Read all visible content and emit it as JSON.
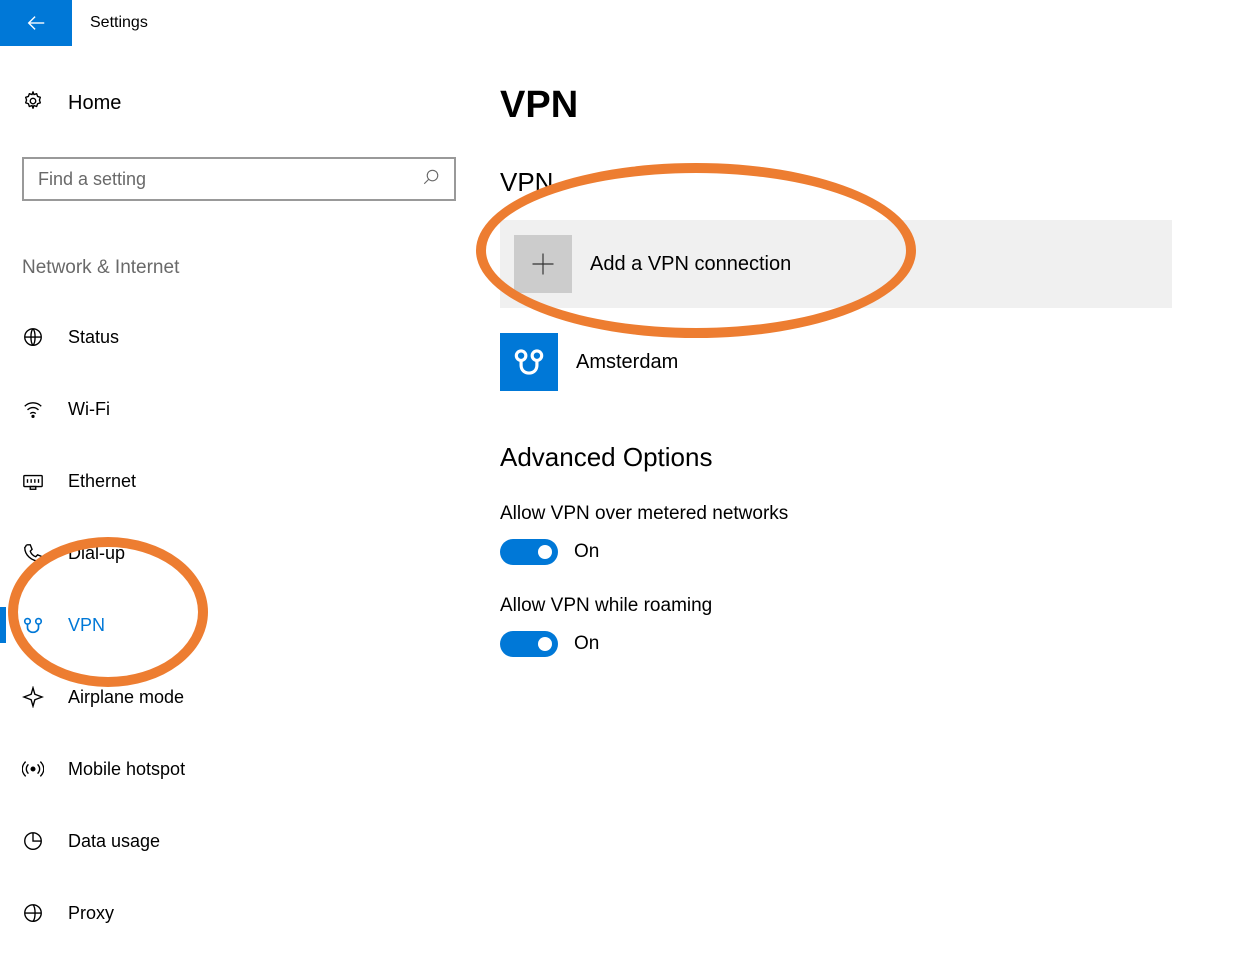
{
  "header": {
    "title": "Settings"
  },
  "sidebar": {
    "home": "Home",
    "search_placeholder": "Find a setting",
    "section": "Network & Internet",
    "items": [
      {
        "label": "Status"
      },
      {
        "label": "Wi-Fi"
      },
      {
        "label": "Ethernet"
      },
      {
        "label": "Dial-up"
      },
      {
        "label": "VPN",
        "active": true
      },
      {
        "label": "Airplane mode"
      },
      {
        "label": "Mobile hotspot"
      },
      {
        "label": "Data usage"
      },
      {
        "label": "Proxy"
      }
    ]
  },
  "main": {
    "title": "VPN",
    "vpn_section": "VPN",
    "add_label": "Add a VPN connection",
    "connections": [
      {
        "name": "Amsterdam"
      }
    ],
    "advanced_title": "Advanced Options",
    "options": [
      {
        "label": "Allow VPN over metered networks",
        "state": "On",
        "on": true
      },
      {
        "label": "Allow VPN while roaming",
        "state": "On",
        "on": true
      }
    ]
  },
  "annotations": {
    "highlight_sidebar_vpn": true,
    "highlight_add_vpn": true
  }
}
